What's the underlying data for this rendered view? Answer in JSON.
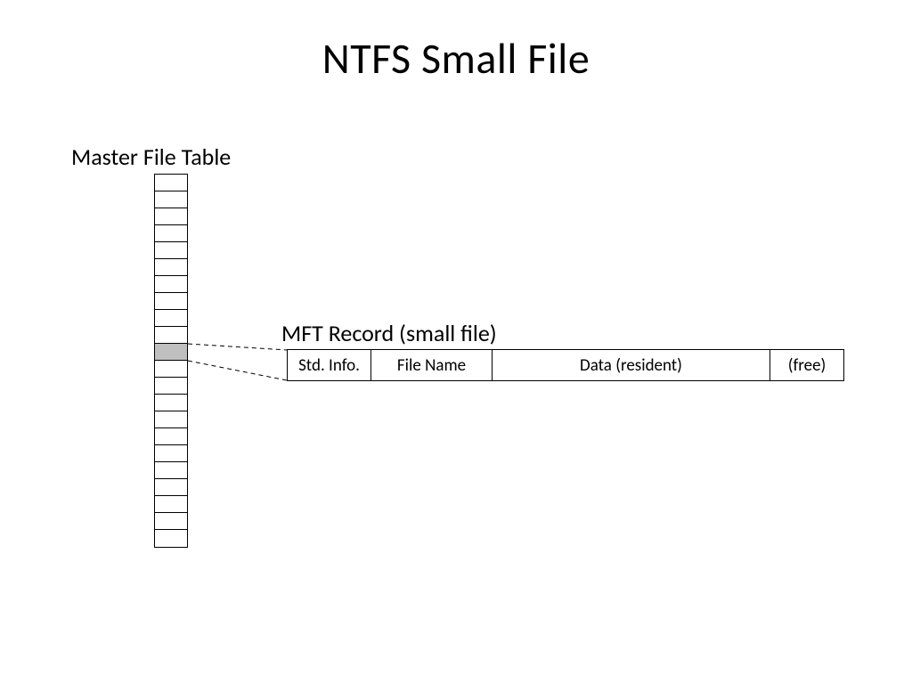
{
  "title": "NTFS Small File",
  "mft_label": "Master File Table",
  "record_label": "MFT Record (small file)",
  "record": {
    "std": "Std. Info.",
    "name": "File Name",
    "data": "Data (resident)",
    "free": "(free)"
  },
  "mft": {
    "row_count": 22,
    "highlighted_row_index": 10
  },
  "colors": {
    "shaded": "#bfbfbf",
    "line": "#000000",
    "bg": "#ffffff"
  }
}
